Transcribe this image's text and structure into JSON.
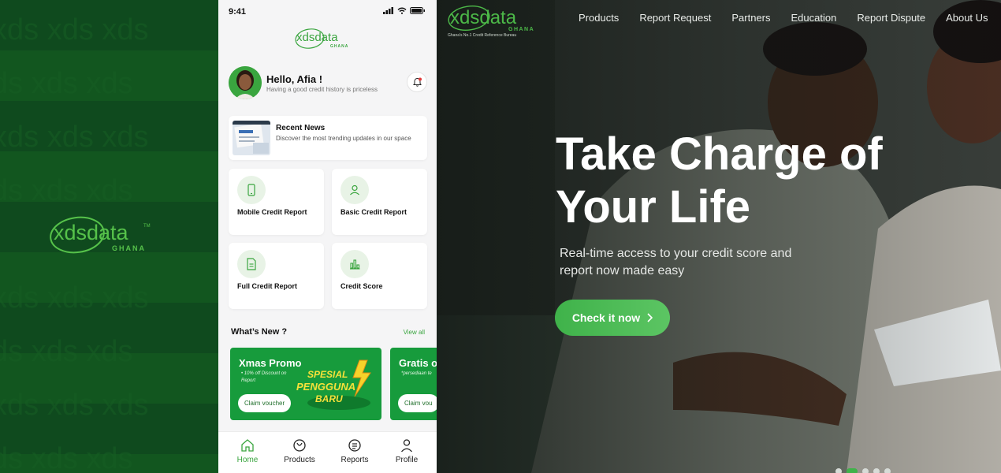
{
  "brand": {
    "logo_text": "xdsdata",
    "logo_sub": "GHANA",
    "tm": "TM"
  },
  "phone": {
    "status_time": "9:41",
    "app_logo_text": "xdsdata",
    "app_logo_sub": "GHANA",
    "greeting": "Hello, Afia !",
    "greeting_sub": "Having a good credit history is priceless",
    "news": {
      "title": "Recent News",
      "desc": "Discover the most trending updates in our space"
    },
    "cards": [
      {
        "label": "Mobile Credit Report",
        "icon": "phone-icon"
      },
      {
        "label": "Basic Credit Report",
        "icon": "user-icon"
      },
      {
        "label": "Full Credit Report",
        "icon": "document-icon"
      },
      {
        "label": "Credit Score",
        "icon": "bar-chart-icon"
      }
    ],
    "whats_new": "What’s New ?",
    "view_all": "View all",
    "promos": [
      {
        "title": "Xmas Promo",
        "desc": "• 10% off Discount on Report",
        "claim": "Claim voucher",
        "art_text_1": "SPESIAL",
        "art_text_2": "PENGGUNA",
        "art_text_3": "BARU"
      },
      {
        "title": "Gratis o",
        "desc": "*persediaan te",
        "claim": "Claim vou"
      }
    ],
    "nav": [
      {
        "label": "Home",
        "icon": "home-icon",
        "active": true
      },
      {
        "label": "Products",
        "icon": "products-icon",
        "active": false
      },
      {
        "label": "Reports",
        "icon": "reports-icon",
        "active": false
      },
      {
        "label": "Profile",
        "icon": "profile-icon",
        "active": false
      }
    ],
    "accent": "#3aa53f"
  },
  "hero": {
    "logo_text": "xdsdata",
    "logo_sub": "GHANA",
    "tagline": "Ghana's No.1 Credit Reference Bureau",
    "menu": [
      "Products",
      "Report Request",
      "Partners",
      "Education",
      "Report Dispute",
      "About Us"
    ],
    "headline_line1": "Take Charge of",
    "headline_line2": "Your Life",
    "subtext": "Real-time access to your credit score and report now made easy",
    "cta": "Check it now",
    "slides": 5,
    "active_slide": 1
  }
}
